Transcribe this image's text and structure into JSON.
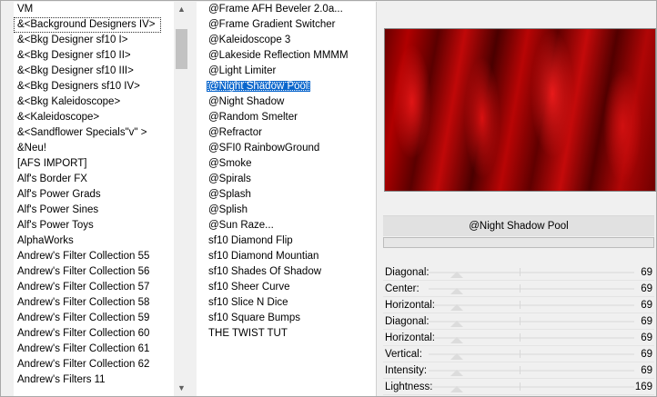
{
  "categories": [
    "VM",
    "&<Background Designers IV>",
    "&<Bkg Designer sf10 I>",
    "&<Bkg Designer sf10 II>",
    "&<Bkg Designer sf10 III>",
    "&<Bkg Designers sf10 IV>",
    "&<Bkg Kaleidoscope>",
    "&<Kaleidoscope>",
    "&<Sandflower Specials\"v\" >",
    "&Neu!",
    "[AFS IMPORT]",
    "Alf's Border FX",
    "Alf's Power Grads",
    "Alf's Power Sines",
    "Alf's Power Toys",
    "AlphaWorks",
    "Andrew's Filter Collection 55",
    "Andrew's Filter Collection 56",
    "Andrew's Filter Collection 57",
    "Andrew's Filter Collection 58",
    "Andrew's Filter Collection 59",
    "Andrew's Filter Collection 60",
    "Andrew's Filter Collection 61",
    "Andrew's Filter Collection 62",
    "Andrew's Filters 11"
  ],
  "filters": [
    "@Frame AFH Beveler 2.0a...",
    "@Frame Gradient Switcher",
    "@Kaleidoscope 3",
    "@Lakeside Reflection MMMM",
    "@Light Limiter",
    "@Night Shadow Pool",
    "@Night Shadow",
    "@Random Smelter",
    "@Refractor",
    "@SFI0 RainbowGround",
    "@Smoke",
    "@Spirals",
    "@Splash",
    "@Splish",
    "@Sun Raze...",
    "sf10 Diamond Flip",
    "sf10 Diamond Mountian",
    "sf10 Shades Of Shadow",
    "sf10 Sheer Curve",
    "sf10 Slice N Dice",
    "sf10 Square Bumps",
    "THE TWIST TUT"
  ],
  "selected_category_index": 1,
  "selected_filter_index": 5,
  "scroll_icons": {
    "up": "scroll-up-arrow-icon",
    "down": "scroll-down-arrow-icon"
  },
  "preset_name": "@Night Shadow Pool",
  "parameters": [
    {
      "label": "Diagonal:",
      "value": "69"
    },
    {
      "label": "Center:",
      "value": "69"
    },
    {
      "label": "Horizontal:",
      "value": "69"
    },
    {
      "label": "Diagonal:",
      "value": "69"
    },
    {
      "label": "Horizontal:",
      "value": "69"
    },
    {
      "label": "Vertical:",
      "value": "69"
    },
    {
      "label": "Intensity:",
      "value": "69"
    },
    {
      "label": "Lightness:",
      "value": "169"
    }
  ],
  "colors": {
    "selection": "#0a66cc",
    "preview_base": "#b00000"
  }
}
